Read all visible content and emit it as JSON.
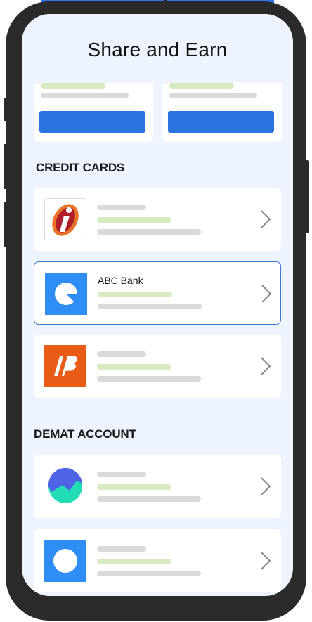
{
  "header": {
    "title": "Share and Earn"
  },
  "sections": {
    "credit_cards": {
      "title": "CREDIT CARDS"
    },
    "demat": {
      "title": "DEMAT ACCOUNT"
    }
  },
  "credit_cards": [
    {
      "name": "",
      "logo": "icici-bank-logo",
      "selected": false
    },
    {
      "name": "ABC Bank",
      "logo": "abc-bank-logo",
      "selected": true
    },
    {
      "name": "",
      "logo": "bank-of-baroda-logo",
      "selected": false
    }
  ],
  "demat_accounts": [
    {
      "name": "",
      "logo": "demat-chart-logo"
    },
    {
      "name": "",
      "logo": "demat-circle-logo"
    }
  ],
  "colors": {
    "accent": "#2b73df",
    "background": "#eef4fd",
    "green_placeholder": "#d7ebc0",
    "grey_placeholder": "#dadada"
  }
}
